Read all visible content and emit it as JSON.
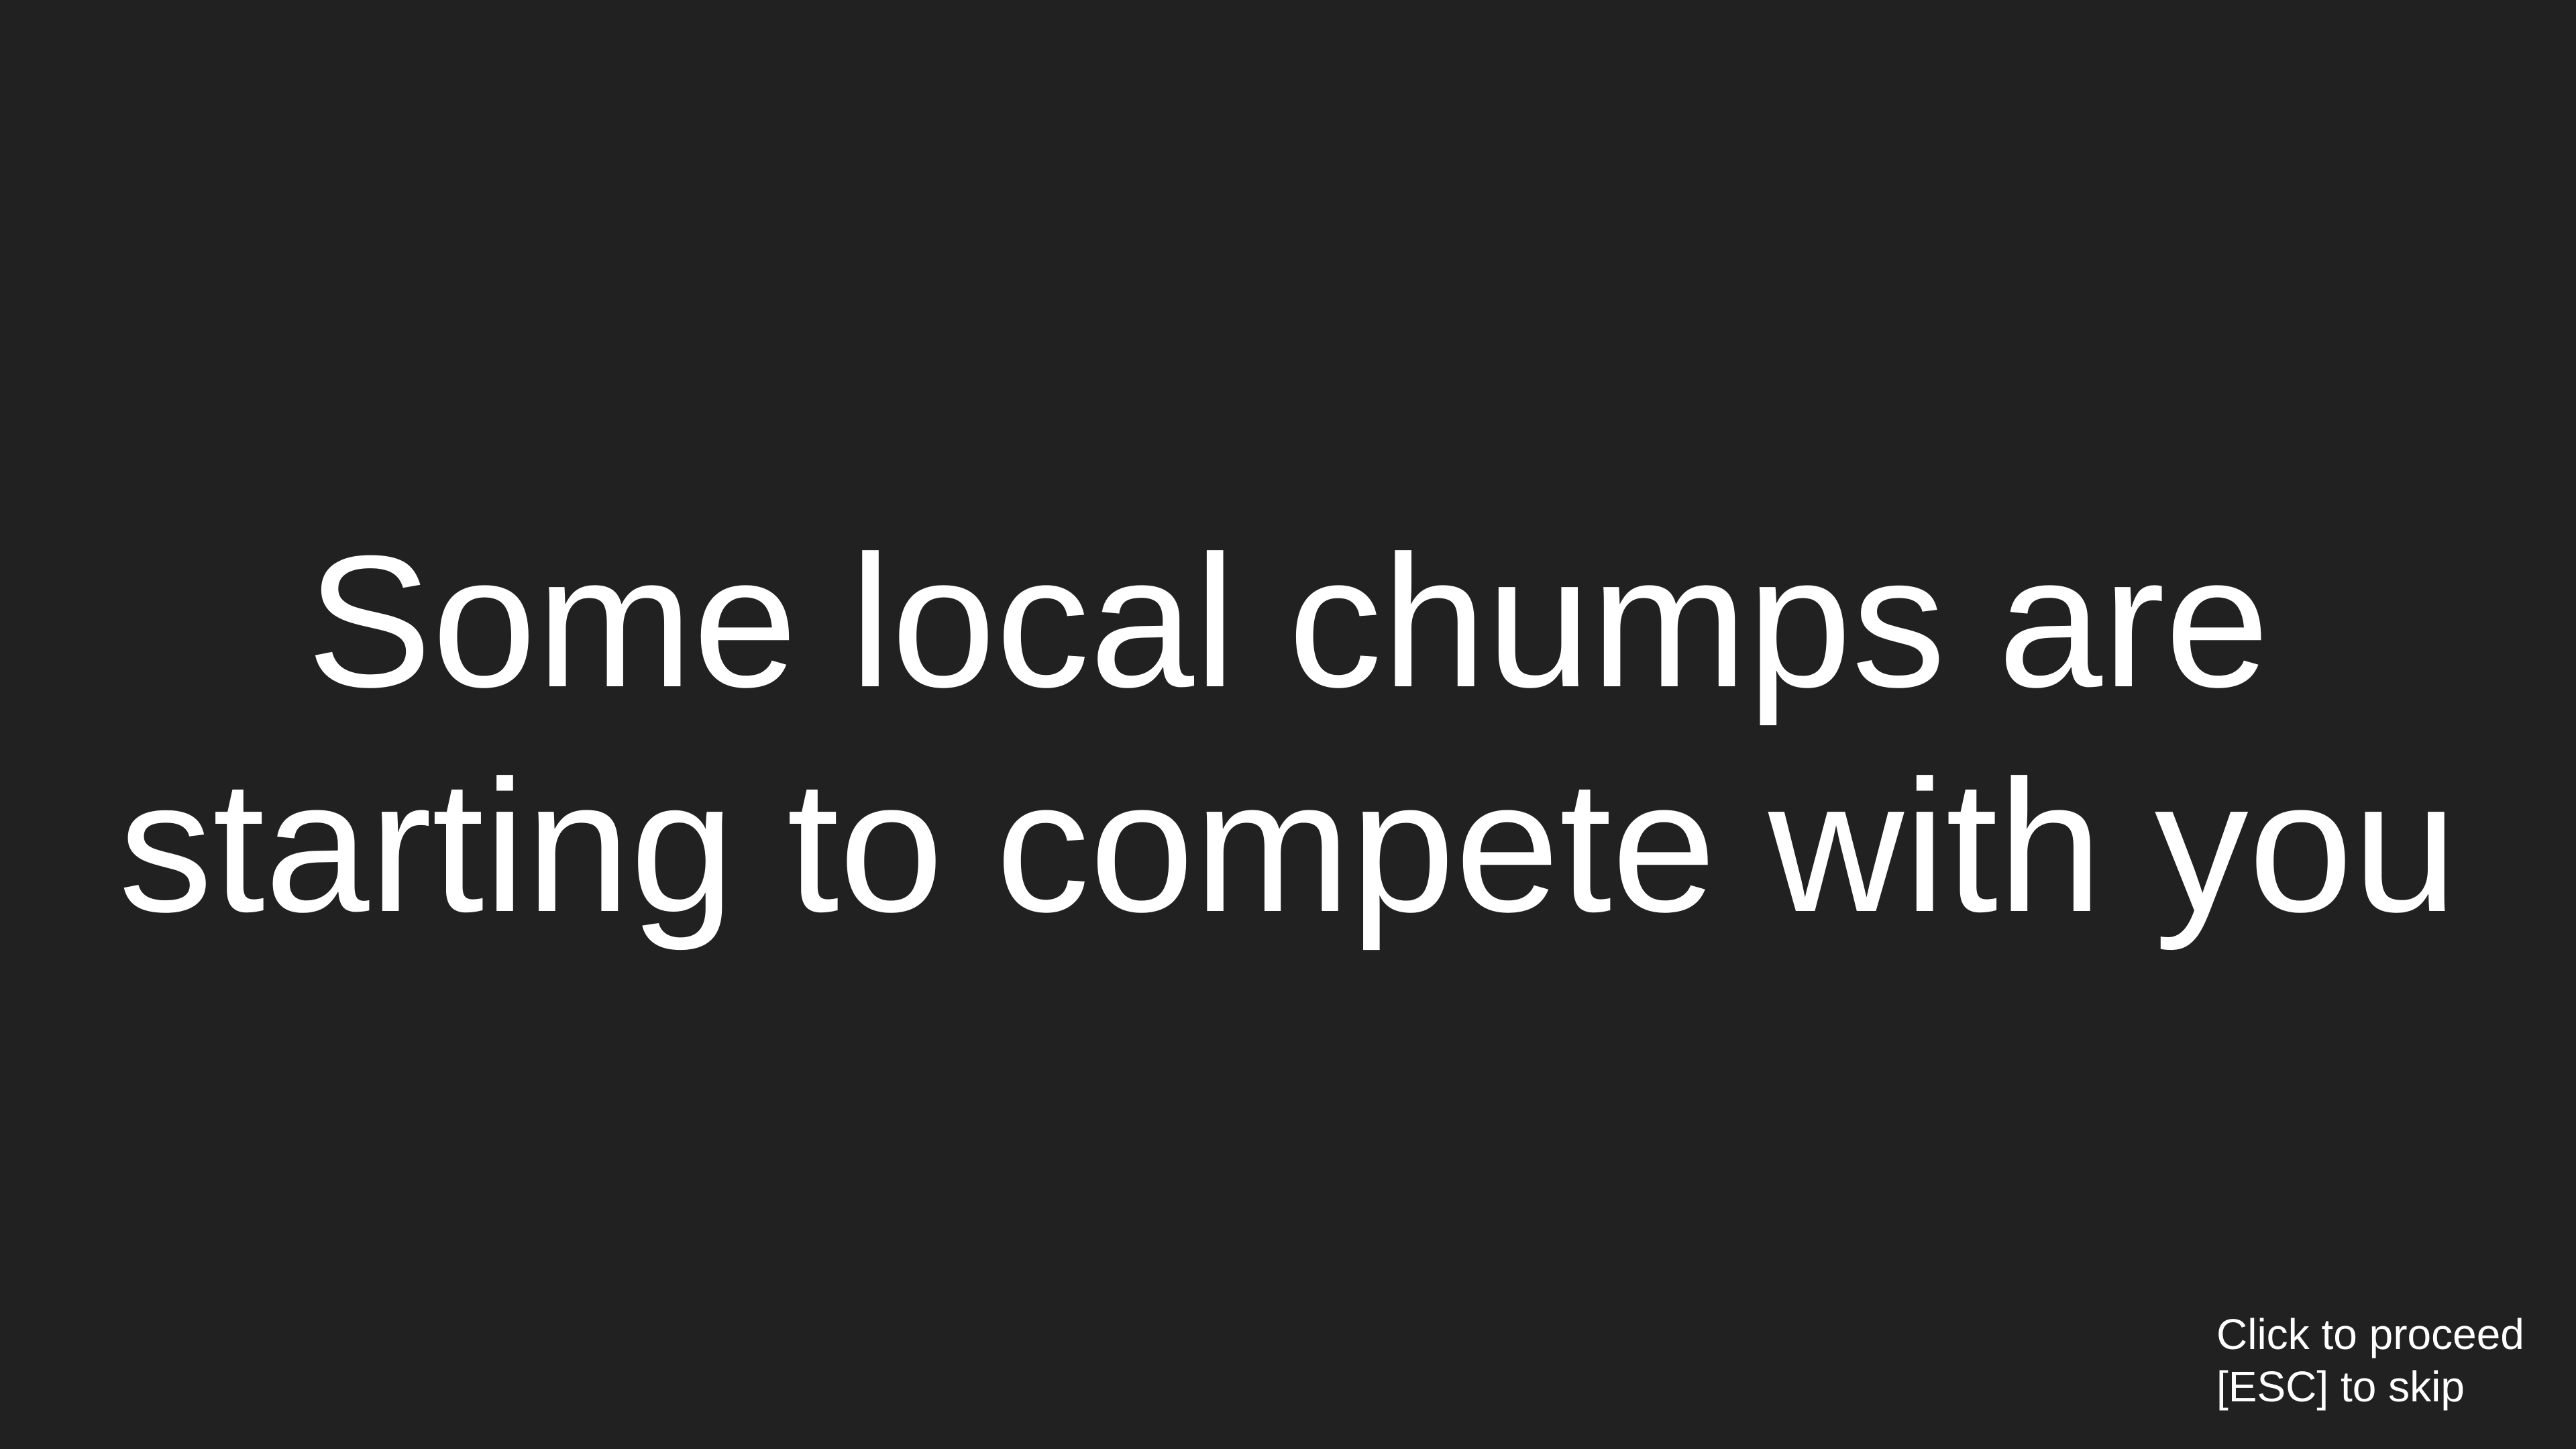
{
  "cutscene": {
    "message_lines": [
      "Some local chumps are",
      "starting to compete with you"
    ]
  },
  "controls": {
    "proceed_hint": "Click to proceed",
    "skip_hint": "[ESC] to skip"
  },
  "colors": {
    "background": "#212121",
    "text": "#ffffff"
  }
}
